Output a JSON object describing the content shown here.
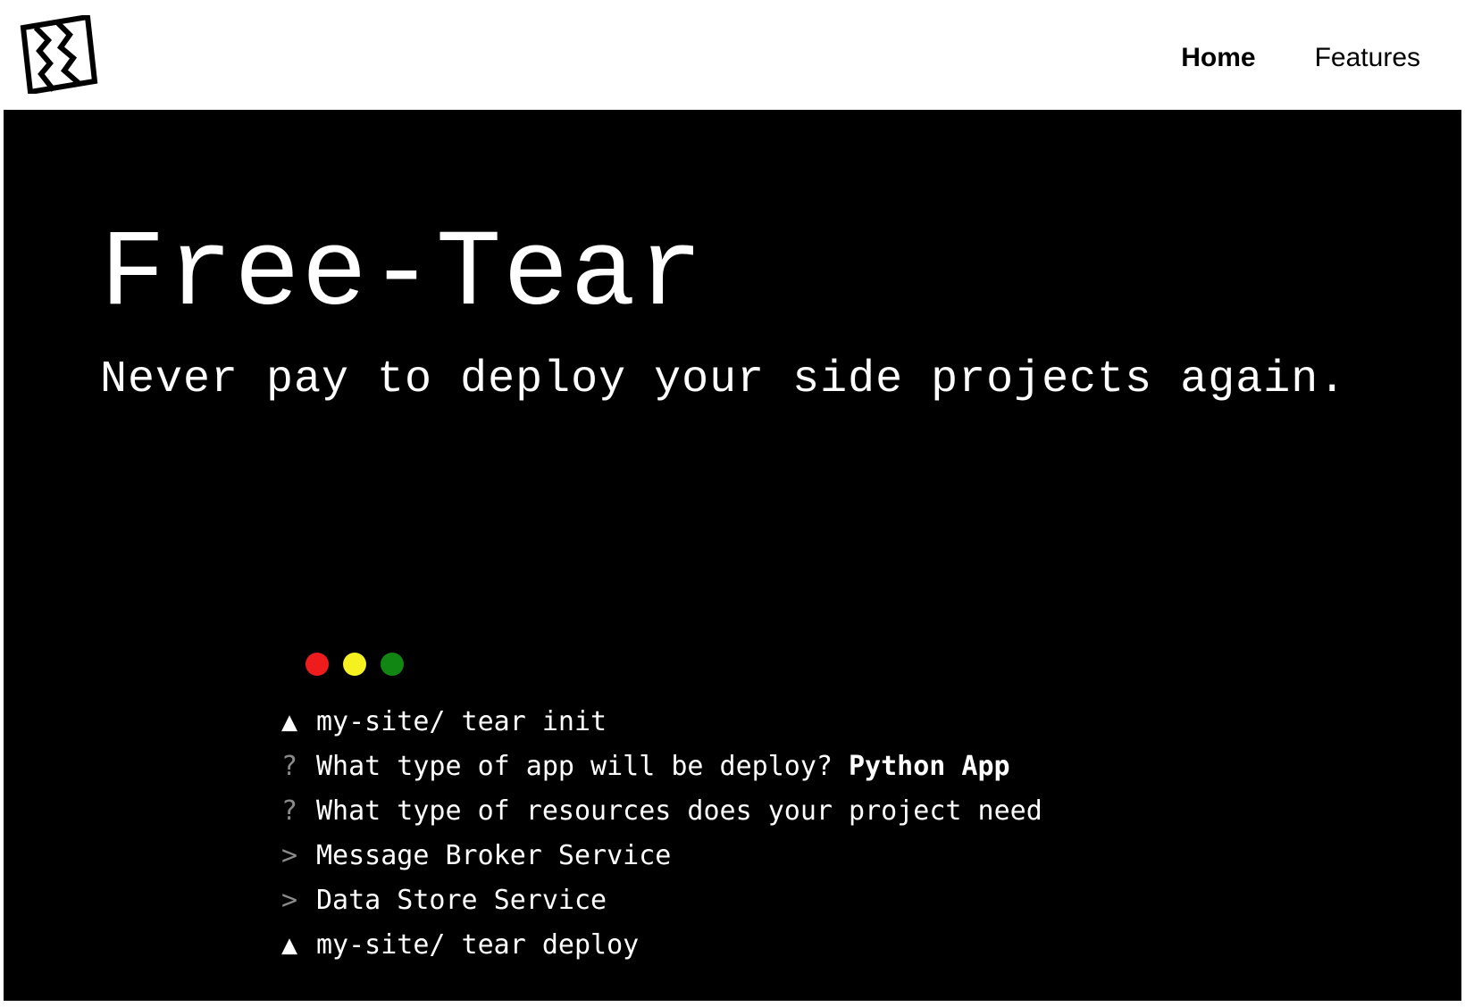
{
  "header": {
    "logo": "free-tear-torn-logo",
    "nav": [
      {
        "label": "Home",
        "active": true
      },
      {
        "label": "Features",
        "active": false
      }
    ]
  },
  "hero": {
    "title": "Free-Tear",
    "subtitle": "Never pay to deploy your side projects again."
  },
  "terminal": {
    "dots": [
      "#ee1c1c",
      "#f5f020",
      "#128612"
    ],
    "lines": [
      {
        "prompt": "▲",
        "text": "my-site/ tear init"
      },
      {
        "prompt": "?",
        "text": "What type of app will be deploy?",
        "answer": "Python App"
      },
      {
        "prompt": "?",
        "text": "What type of resources does your project need"
      },
      {
        "prompt": ">",
        "text": "Message Broker Service"
      },
      {
        "prompt": ">",
        "text": "Data Store Service"
      },
      {
        "prompt": "▲",
        "text": "my-site/ tear deploy"
      }
    ]
  }
}
